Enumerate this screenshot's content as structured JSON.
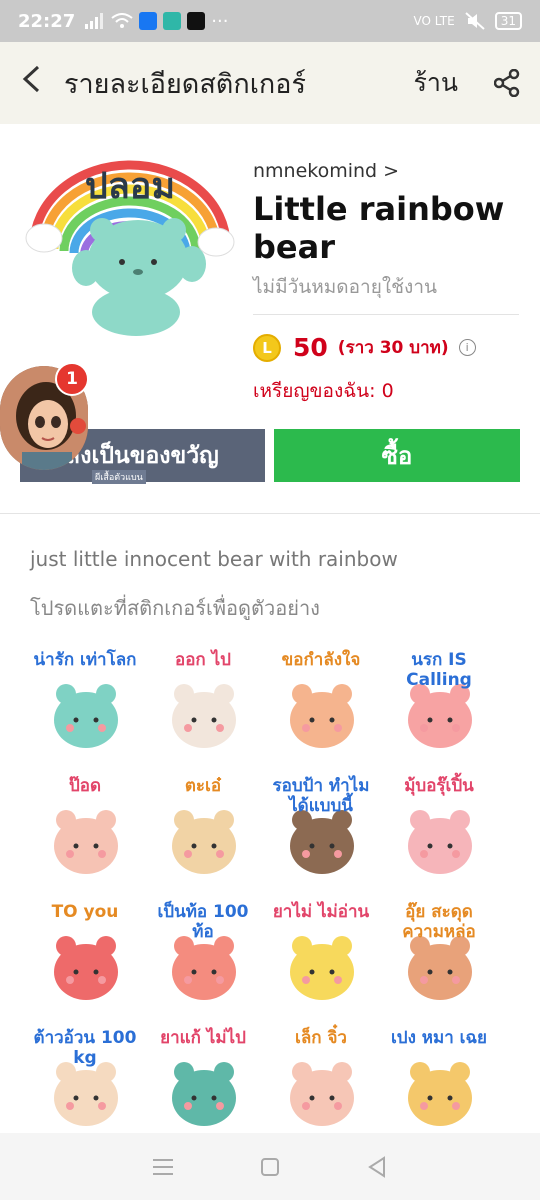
{
  "status_bar": {
    "time": "22:27",
    "more": "···",
    "network": "VO LTE",
    "battery": "31"
  },
  "header": {
    "back_icon": "chevron-left-icon",
    "title": "รายละเอียดสติกเกอร์",
    "shop_label": "ร้าน",
    "share_icon": "share-icon",
    "bg_color": "#f4f3ec"
  },
  "main_sticker": {
    "text": "ปลอม"
  },
  "product": {
    "author": "nmnekomind >",
    "name": "Little rainbow bear",
    "validity": "ไม่มีวันหมดอายุใช้งาน",
    "coin_letter": "L",
    "price": "50",
    "approx_price": "(ราว 30 บาท)",
    "my_coins": "เหรียญของฉัน: 0"
  },
  "buttons": {
    "gift": "ส่งเป็นของขวัญ",
    "buy": "ซื้อ",
    "gift_color": "#5a6478",
    "buy_color": "#2cba4d"
  },
  "floating_avatar": {
    "badge_count": "1",
    "tag": "ผีเสื้อตัวแบน"
  },
  "description": "just little innocent bear with rainbow",
  "hint": "โปรดแตะที่สติกเกอร์เพื่อดูตัวอย่าง",
  "stickers": [
    {
      "label": "น่ารัก เท่าโลก",
      "color": "#7fd2c4"
    },
    {
      "label": "ออก ไป",
      "color": "#f2e6dc"
    },
    {
      "label": "ขอกำลังใจ",
      "color": "#f5b48e"
    },
    {
      "label": "นรก IS Calling",
      "color": "#f7a3a3"
    },
    {
      "label": "ป๊อด",
      "color": "#f6c3b4"
    },
    {
      "label": "ตะเอ๋",
      "color": "#f1d3a5"
    },
    {
      "label": "รอบป้า ทำไมได้แบบนี้",
      "color": "#8c6a52"
    },
    {
      "label": "มุ้บอรุ๊เปิ้น",
      "color": "#f6b5ba"
    },
    {
      "label": "TO you",
      "color": "#ee6a6a"
    },
    {
      "label": "เป็นท้อ 100 ท้อ",
      "color": "#f48c7f"
    },
    {
      "label": "ยาไม่ ไม่อ่าน",
      "color": "#f7d95c"
    },
    {
      "label": "อุ๊ย สะดุด ความหล่อ",
      "color": "#e8a27a"
    },
    {
      "label": "ต้าวอ้วน 100 kg",
      "color": "#f5dac0"
    },
    {
      "label": "ยาแก้ ไม่ไป",
      "color": "#5fb8a8"
    },
    {
      "label": "เล็ก จิ๋ว",
      "color": "#f6c6b6"
    },
    {
      "label": "เปง หมา เฉย",
      "color": "#f4c86b"
    }
  ]
}
